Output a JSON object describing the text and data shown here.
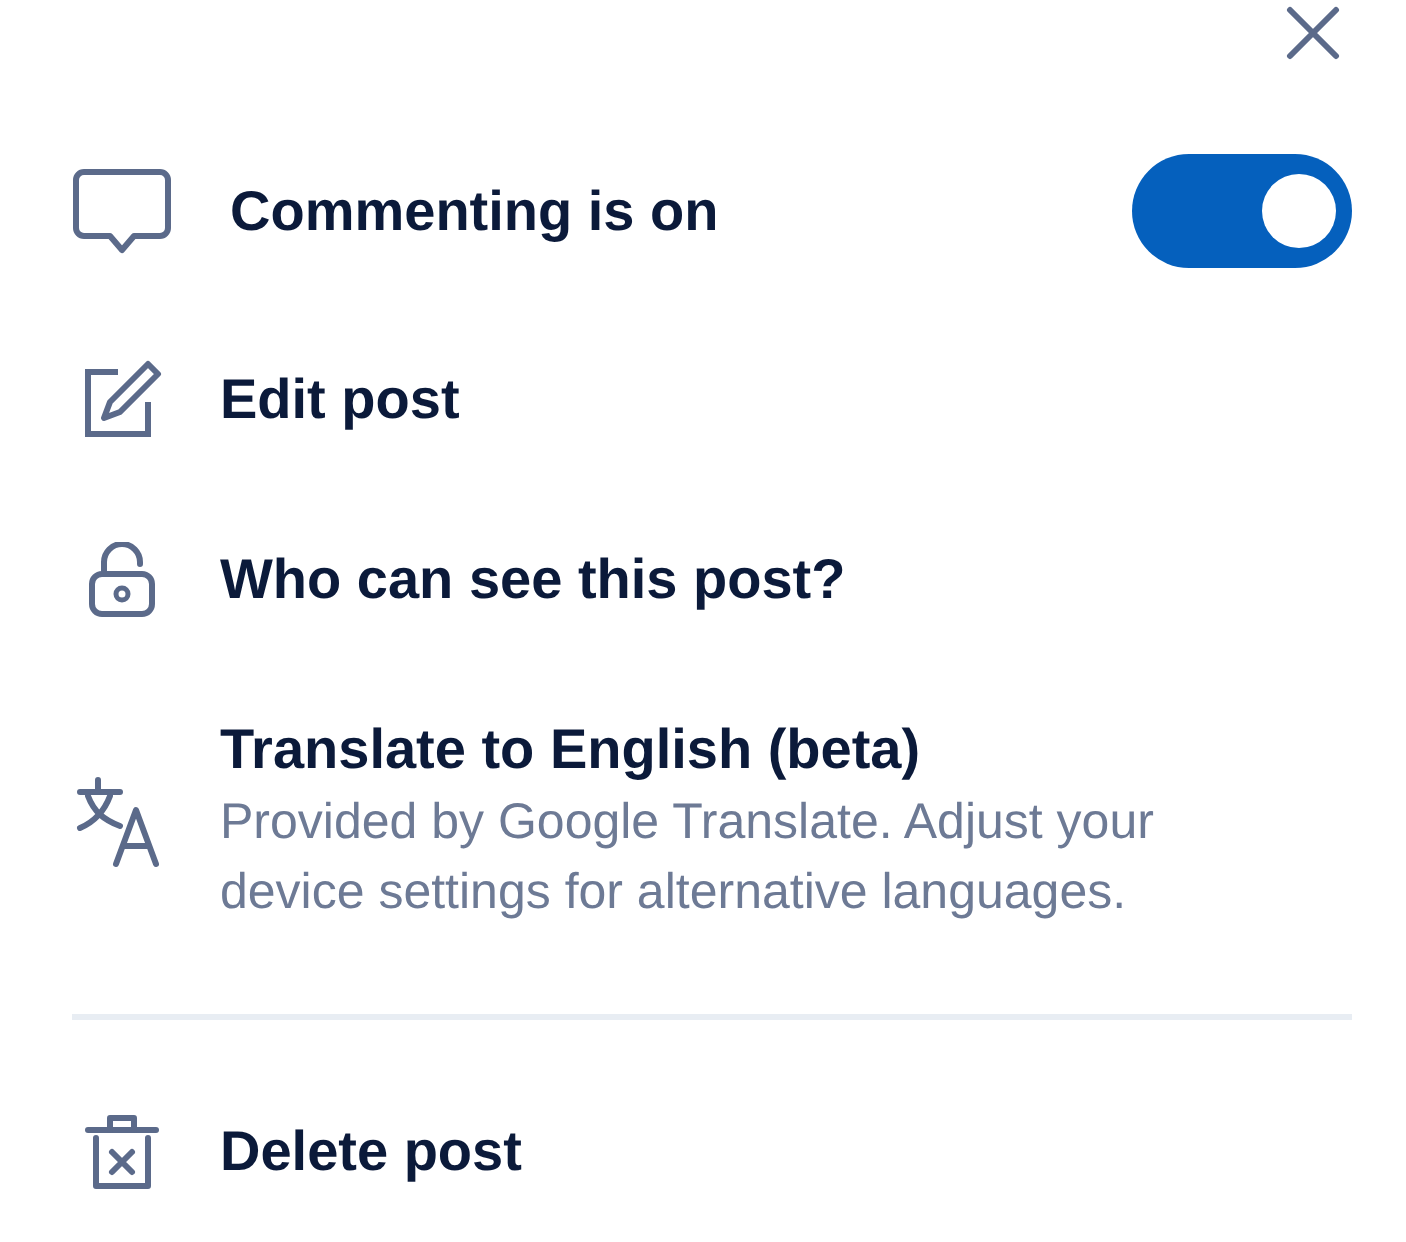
{
  "sections": [
    {
      "items": [
        {
          "kind": "toggle",
          "label": "Commenting is on",
          "on": true
        },
        {
          "kind": "action",
          "label": "Edit post"
        },
        {
          "kind": "action",
          "label": "Who can see this post?"
        },
        {
          "kind": "detail",
          "label": "Translate to English (beta)",
          "description": "Provided by Google Translate. Adjust your device settings for alternative languages."
        }
      ]
    },
    {
      "items": [
        {
          "kind": "action",
          "label": "Delete post"
        }
      ]
    }
  ]
}
